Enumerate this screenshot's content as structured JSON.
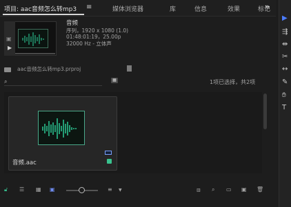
{
  "tabs": {
    "project": "项目: aac音频怎么转mp3",
    "media_browser": "媒体浏览器",
    "library": "库",
    "info": "信息",
    "effects": "效果",
    "markers": "标记"
  },
  "clip_info": {
    "name": "音频",
    "type": "序列，1920 x 1080 (1.0)",
    "timecode": "01:48:01:19，25.00p",
    "audio": "32000 Hz - 立体声"
  },
  "project_file": "aac音频怎么转mp3.prproj",
  "search": {
    "placeholder": ""
  },
  "selection_status": "1项已选择，共2项",
  "items": [
    {
      "label": "音频.aac"
    }
  ],
  "accent_colors": {
    "waveform": "#2fd7a0",
    "selection_tool": "#4c7dff",
    "label_green": "#39c38f"
  },
  "toolbar_icons": [
    "selection-tool-icon",
    "track-select-icon",
    "ripple-edit-icon",
    "razor-icon",
    "slip-icon",
    "pen-icon",
    "hand-icon",
    "type-icon"
  ]
}
